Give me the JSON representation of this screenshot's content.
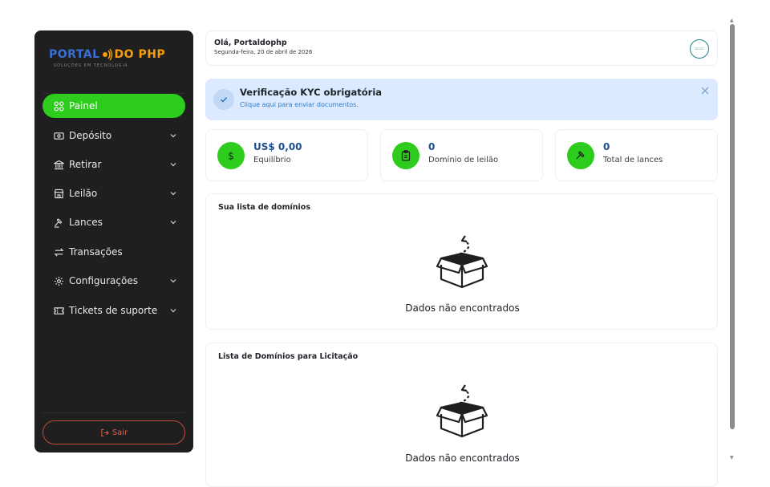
{
  "brand": {
    "logo_part1": "PORTAL",
    "logo_part2": "DO PHP",
    "tagline": "SOLUÇÕES EM TECNOLOGIA"
  },
  "sidebar": {
    "items": [
      {
        "label": "Painel",
        "icon": "grid-icon",
        "active": true,
        "has_submenu": false
      },
      {
        "label": "Depósito",
        "icon": "wallet-icon",
        "active": false,
        "has_submenu": true
      },
      {
        "label": "Retirar",
        "icon": "bank-icon",
        "active": false,
        "has_submenu": true
      },
      {
        "label": "Leilão",
        "icon": "store-icon",
        "active": false,
        "has_submenu": true
      },
      {
        "label": "Lances",
        "icon": "gavel-icon",
        "active": false,
        "has_submenu": true
      },
      {
        "label": "Transações",
        "icon": "transfer-icon",
        "active": false,
        "has_submenu": false
      },
      {
        "label": "Configurações",
        "icon": "gear-icon",
        "active": false,
        "has_submenu": true
      },
      {
        "label": "Tickets de suporte",
        "icon": "ticket-icon",
        "active": false,
        "has_submenu": true
      }
    ],
    "logout_label": "Sair"
  },
  "header": {
    "greeting": "Olá, Portaldophp",
    "date": "Segunda-feira, 20 de abril de 2026",
    "avatar_text": "CC-CC"
  },
  "kyc": {
    "title": "Verificação KYC obrigatória",
    "subtitle": "Clique aqui para enviar documentos."
  },
  "stats": [
    {
      "value": "US$ 0,00",
      "label": "Equilíbrio",
      "icon": "dollar-icon"
    },
    {
      "value": "0",
      "label": "Domínio de leilão",
      "icon": "clipboard-icon"
    },
    {
      "value": "0",
      "label": "Total de lances",
      "icon": "gavel-icon"
    }
  ],
  "panels": [
    {
      "title": "Sua lista de domínios",
      "empty_text": "Dados não encontrados"
    },
    {
      "title": "Lista de Domínios para Licitação",
      "empty_text": "Dados não encontrados"
    }
  ],
  "colors": {
    "accent": "#2ecc1c",
    "sidebar_bg": "#1f1f1f",
    "kyc_bg": "#dbeafe",
    "stat_value": "#1b4d8f",
    "logout": "#e45d4a"
  }
}
